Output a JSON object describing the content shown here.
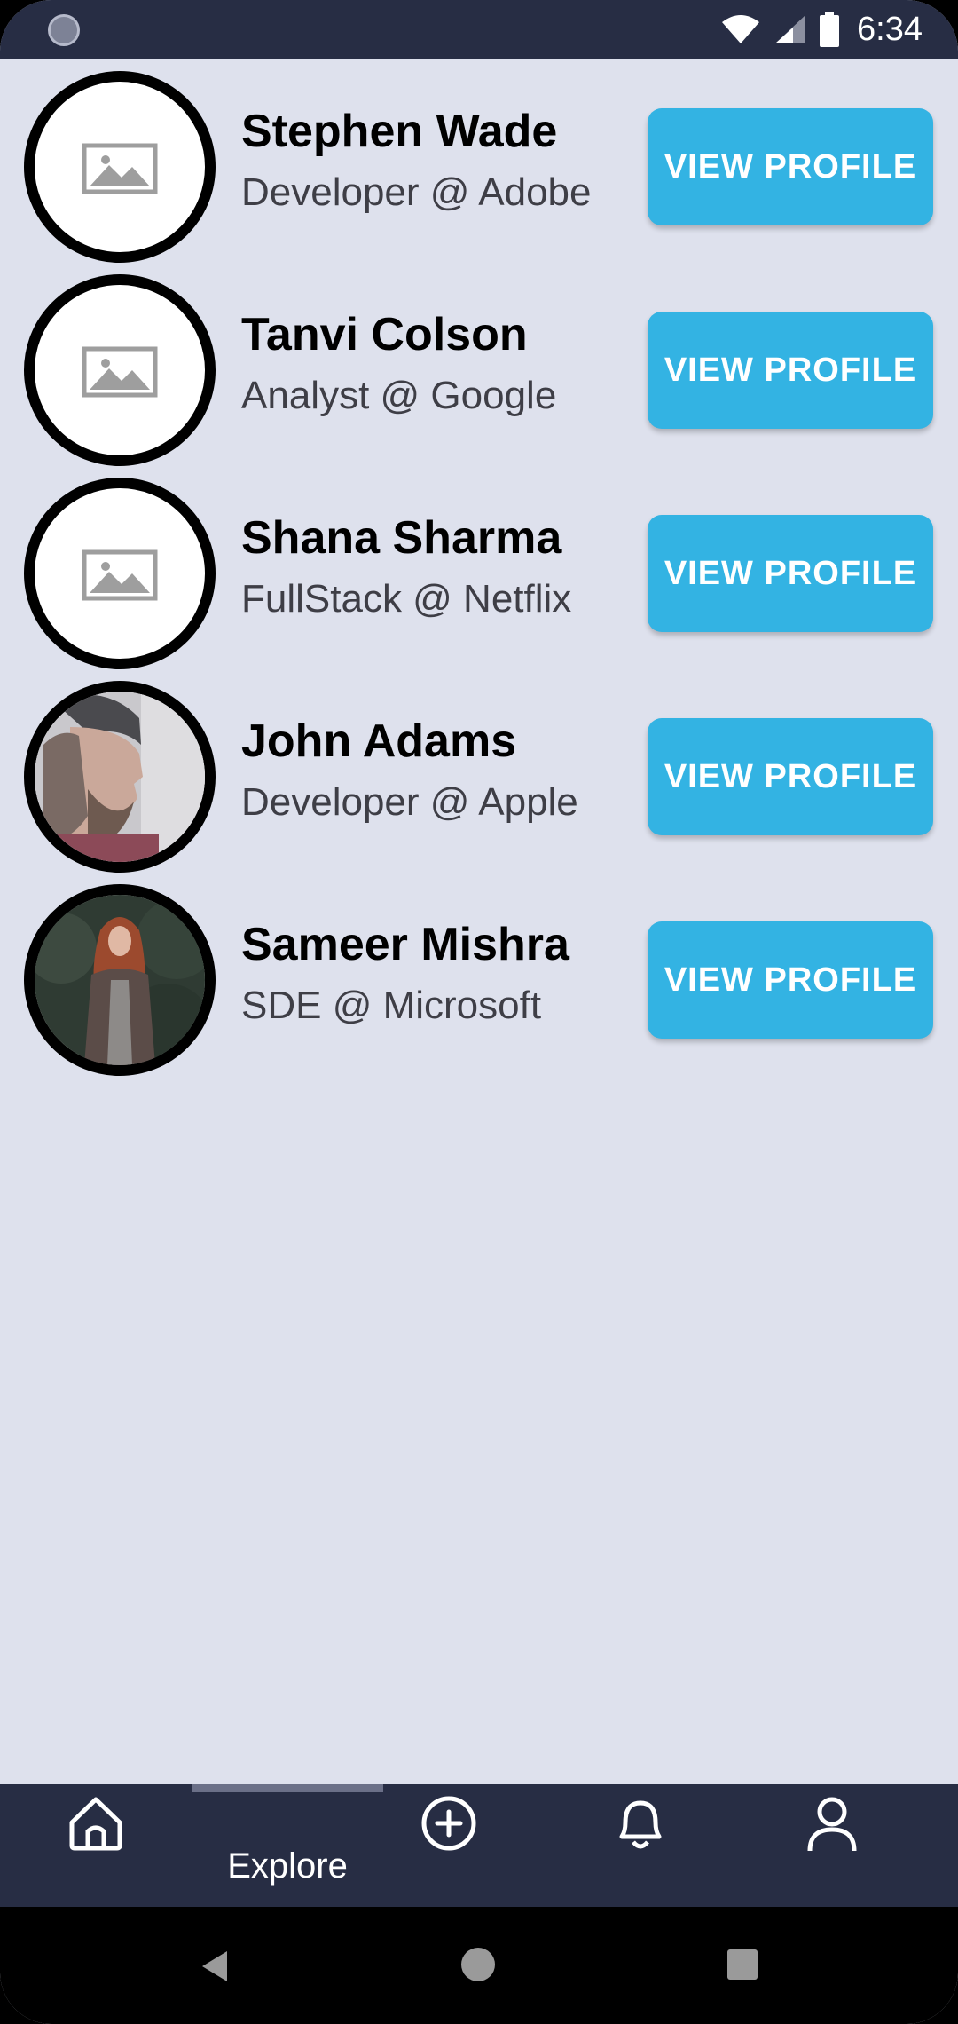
{
  "status_bar": {
    "time": "6:34",
    "icons": [
      "wifi-icon",
      "signal-icon",
      "battery-icon"
    ]
  },
  "profiles": [
    {
      "name": "Stephen Wade",
      "role": "Developer @ Adobe",
      "button": "VIEW PROFILE",
      "avatar": "placeholder-image-icon"
    },
    {
      "name": "Tanvi Colson",
      "role": "Analyst @ Google",
      "button": "VIEW PROFILE",
      "avatar": "placeholder-image-icon"
    },
    {
      "name": "Shana Sharma",
      "role": "FullStack @ Netflix",
      "button": "VIEW PROFILE",
      "avatar": "placeholder-image-icon"
    },
    {
      "name": "John Adams",
      "role": "Developer @ Apple",
      "button": "VIEW PROFILE",
      "avatar": "photo-man-profile"
    },
    {
      "name": "Sameer Mishra",
      "role": "SDE @ Microsoft",
      "button": "VIEW PROFILE",
      "avatar": "photo-woman-forest"
    }
  ],
  "bottom_nav": {
    "items": [
      {
        "icon": "home-icon",
        "label": ""
      },
      {
        "icon": "explore",
        "label": "Explore",
        "active": true
      },
      {
        "icon": "add-circle-icon",
        "label": ""
      },
      {
        "icon": "bell-icon",
        "label": ""
      },
      {
        "icon": "user-icon",
        "label": ""
      }
    ]
  },
  "colors": {
    "background": "#dee1ed",
    "bar": "#272d44",
    "button": "#33b3e3"
  }
}
